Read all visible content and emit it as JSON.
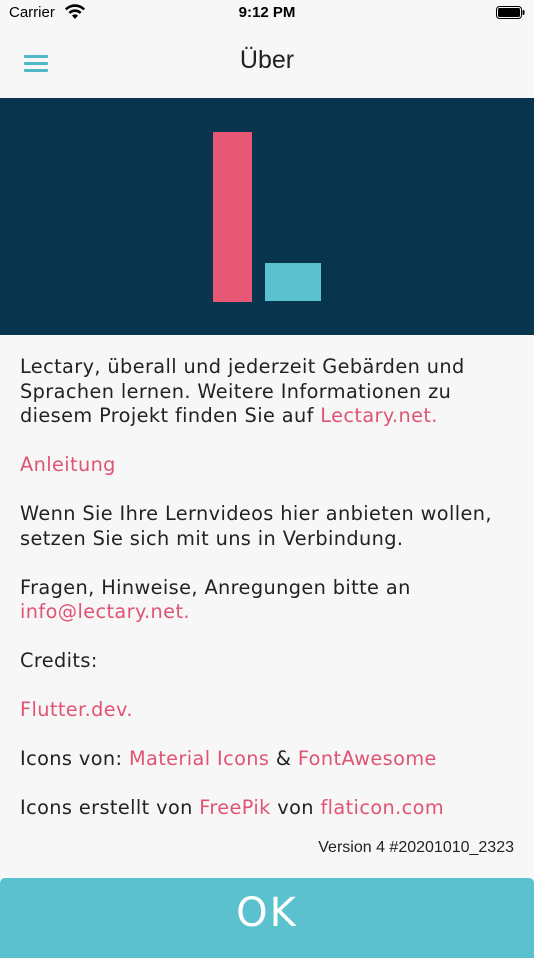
{
  "status_bar": {
    "carrier": "Carrier",
    "time": "9:12 PM",
    "wifi_icon": "wifi-icon",
    "battery_icon": "battery-icon"
  },
  "app_bar": {
    "title": "Über",
    "menu_icon": "hamburger-menu-icon"
  },
  "banner": {
    "background_color": "#08354d",
    "logo_colors": [
      "#e85874",
      "#5bc1cf"
    ]
  },
  "content": {
    "intro_text": "Lectary, überall und jederzeit Gebärden und Sprachen lernen. Weitere Informationen zu diesem Projekt finden Sie auf ",
    "intro_link": "Lectary.net.",
    "guide_link": "Anleitung",
    "videos_text": "Wenn Sie Ihre Lernvideos hier anbieten wollen, setzen Sie sich mit uns in Verbindung.",
    "questions_text": "Fragen, Hinweise, Anregungen bitte an ",
    "email_link": "info@lectary.net.",
    "credits_label": "Credits:",
    "flutter_link": "Flutter.dev.",
    "icons_text": "Icons von: ",
    "material_icons_link": "Material Icons",
    "ampersand": " & ",
    "fontawesome_link": "FontAwesome",
    "icons_created_text": "Icons erstellt von ",
    "freepik_link": "FreePik",
    "von_text": " von ",
    "flaticon_link": "flaticon.com"
  },
  "version": "Version 4 #20201010_2323",
  "ok_button": {
    "label": "OK"
  },
  "colors": {
    "accent": "#5bc1cf",
    "link": "#e05473",
    "background": "#f7f7f7"
  }
}
